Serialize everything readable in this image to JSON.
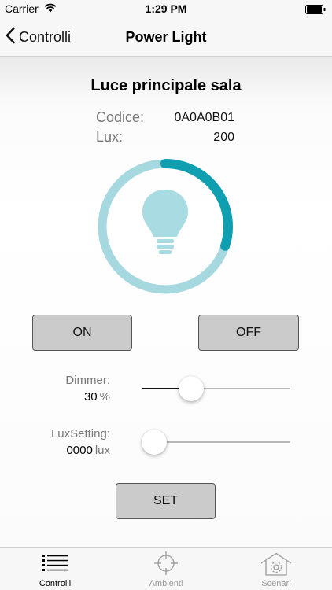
{
  "status_bar": {
    "carrier": "Carrier",
    "time": "1:29 PM"
  },
  "nav": {
    "back_label": "Controlli",
    "title": "Power Light"
  },
  "device": {
    "name": "Luce principale sala",
    "code_label": "Codice:",
    "code_value": "0A0A0B01",
    "lux_label": "Lux:",
    "lux_value": "200"
  },
  "ring": {
    "level": 0.3,
    "track_color": "#a5d8df",
    "fill_color": "#0f9fb0",
    "bulb_color": "#a9dbe2"
  },
  "buttons": {
    "on": "ON",
    "off": "OFF",
    "set": "SET"
  },
  "dimmer": {
    "label": "Dimmer:",
    "value": "30",
    "unit": "%",
    "level": 0.3
  },
  "lux_setting": {
    "label": "LuxSetting:",
    "value": "0000",
    "unit": "lux",
    "level": 0.0
  },
  "tabs": [
    {
      "label": "Controlli",
      "icon": "list-icon",
      "active": true
    },
    {
      "label": "Ambienti",
      "icon": "crosshair-icon",
      "active": false
    },
    {
      "label": "Scenari",
      "icon": "house-gear-icon",
      "active": false
    }
  ],
  "colors": {
    "active_tab": "#000000",
    "inactive_tab": "#9a9a9a"
  }
}
